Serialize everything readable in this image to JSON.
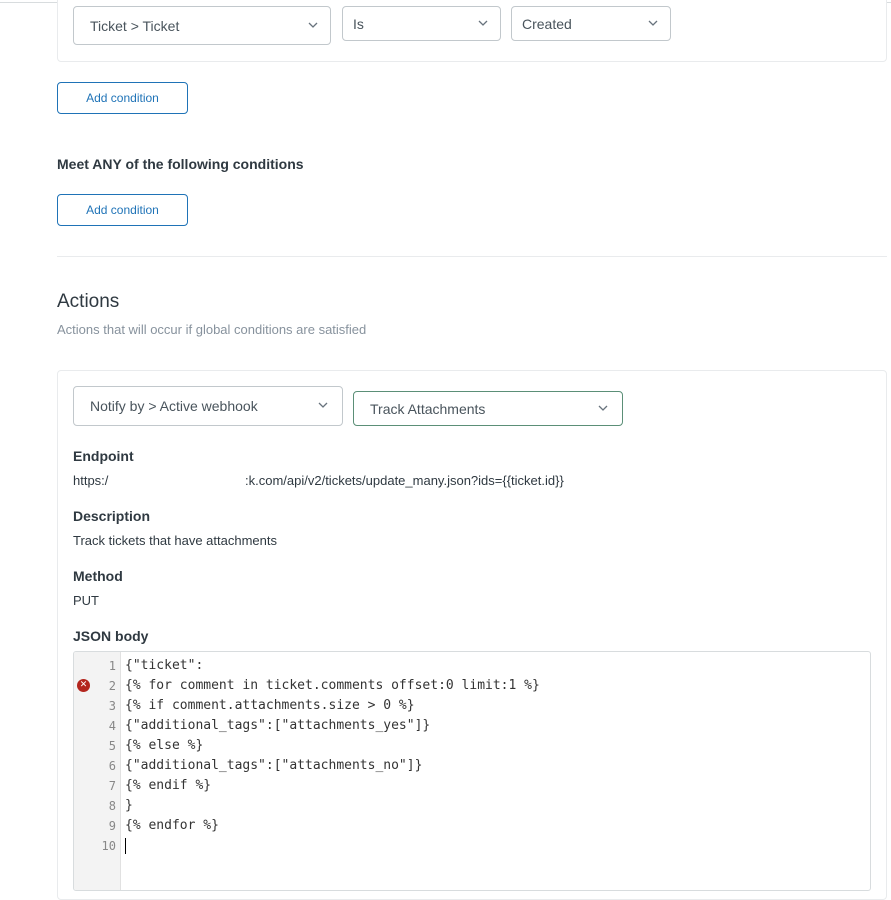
{
  "conditions_all": {
    "field": "Ticket > Ticket",
    "operator": "Is",
    "value": "Created",
    "add_label": "Add condition"
  },
  "conditions_any": {
    "heading": "Meet ANY of the following conditions",
    "add_label": "Add condition"
  },
  "actions": {
    "title": "Actions",
    "subtitle": "Actions that will occur if global conditions are satisfied",
    "action_select": "Notify by > Active webhook",
    "webhook_select": "Track Attachments"
  },
  "webhook": {
    "endpoint_label": "Endpoint",
    "endpoint_prefix": "https:/",
    "endpoint_suffix": ":k.com/api/v2/tickets/update_many.json?ids={{ticket.id}}",
    "description_label": "Description",
    "description": "Track tickets that have attachments",
    "method_label": "Method",
    "method": "PUT",
    "json_label": "JSON body"
  },
  "json_body": {
    "lines": [
      {
        "n": "1",
        "text": "{\"ticket\":"
      },
      {
        "n": "2",
        "text": "{% for comment in ticket.comments offset:0 limit:1 %}"
      },
      {
        "n": "3",
        "text": "{% if comment.attachments.size > 0 %}"
      },
      {
        "n": "4",
        "text": "{\"additional_tags\":[\"attachments_yes\"]}"
      },
      {
        "n": "5",
        "text": "{% else %}"
      },
      {
        "n": "6",
        "text": "{\"additional_tags\":[\"attachments_no\"]}"
      },
      {
        "n": "7",
        "text": "{% endif %}"
      },
      {
        "n": "8",
        "text": "}"
      },
      {
        "n": "9",
        "text": "{% endfor %}"
      },
      {
        "n": "10",
        "text": ""
      }
    ],
    "error_line": "2"
  },
  "icons": {
    "chevron": "chevron-down-icon",
    "error": "error-icon"
  }
}
